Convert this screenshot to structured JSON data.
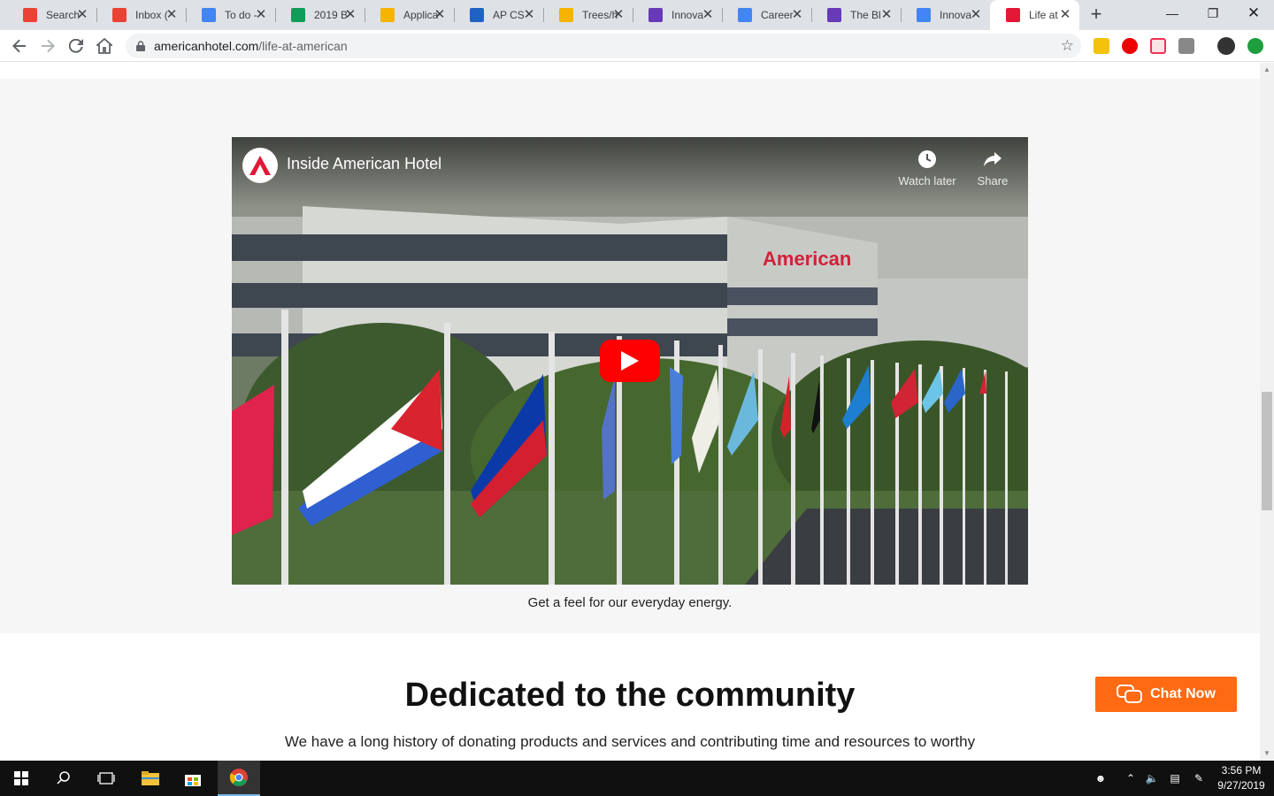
{
  "browser": {
    "tabs": [
      {
        "title": "Search",
        "icon": "gmail-icon",
        "color": "#ea4335"
      },
      {
        "title": "Inbox (",
        "icon": "gmail-icon",
        "color": "#ea4335"
      },
      {
        "title": "To do -",
        "icon": "docs-icon",
        "color": "#4285f4"
      },
      {
        "title": "2019 B",
        "icon": "sheets-icon",
        "color": "#0f9d58"
      },
      {
        "title": "Applica",
        "icon": "slides-icon",
        "color": "#f4b400"
      },
      {
        "title": "AP CS",
        "icon": "classroom-icon",
        "color": "#1e63c4"
      },
      {
        "title": "Trees/h",
        "icon": "classroom-icon",
        "color": "#f4b400"
      },
      {
        "title": "Innova",
        "icon": "forms-icon",
        "color": "#673ab7"
      },
      {
        "title": "Career",
        "icon": "docs-icon",
        "color": "#4285f4"
      },
      {
        "title": "The Bl",
        "icon": "forms-icon",
        "color": "#673ab7"
      },
      {
        "title": "Innova",
        "icon": "docs-icon",
        "color": "#4285f4"
      },
      {
        "title": "Life at",
        "icon": "american-hotel-icon",
        "color": "#e31837",
        "active": true
      }
    ],
    "url_domain": "americanhotel.com",
    "url_path": "/life-at-american"
  },
  "page": {
    "video": {
      "title": "Inside American Hotel",
      "watch_later": "Watch later",
      "share": "Share"
    },
    "caption": "Get a feel for our everyday energy.",
    "heading": "Dedicated to the community",
    "paragraph": "We have a long history of donating products and services and contributing time and resources to worthy",
    "chat_button": "Chat Now",
    "accent_color": "#ff6a13"
  },
  "taskbar": {
    "time": "3:56 PM",
    "date": "9/27/2019"
  }
}
